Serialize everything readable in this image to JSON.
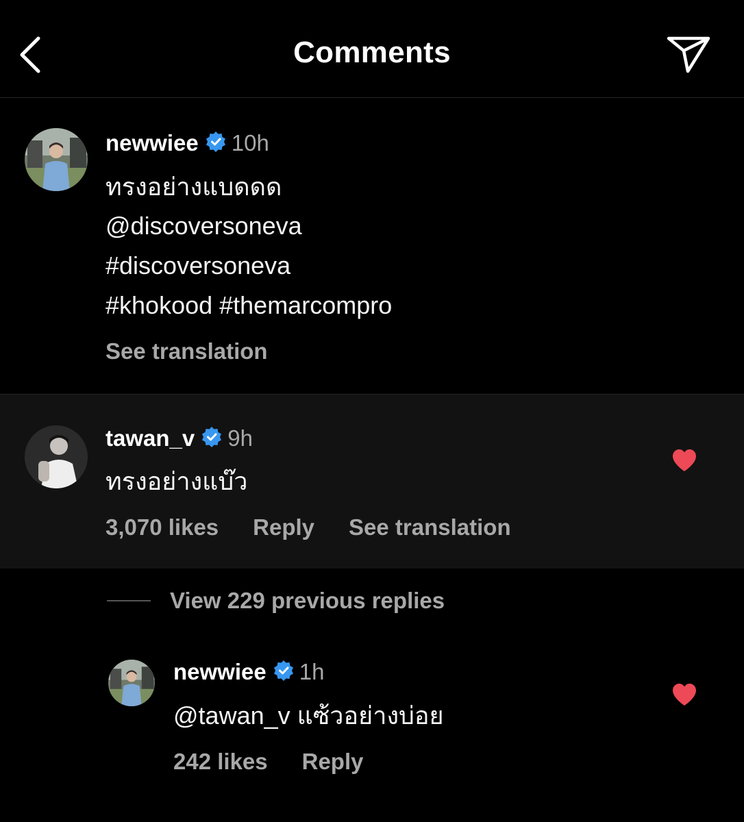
{
  "header": {
    "title": "Comments"
  },
  "caption": {
    "username": "newwiee",
    "time": "10h",
    "lines": [
      "ทรงอย่างแบดดด",
      "@discoversoneva",
      "#discoversoneva",
      "#khokood #themarcompro"
    ],
    "see_translation": "See translation"
  },
  "comment": {
    "username": "tawan_v",
    "time": "9h",
    "text": "ทรงอย่างแบ๊ว",
    "likes": "3,070 likes",
    "reply": "Reply",
    "see_translation": "See translation",
    "liked": true
  },
  "view_replies": "View 229 previous replies",
  "reply": {
    "username": "newwiee",
    "time": "1h",
    "mention": "@tawan_v",
    "text": "แซ้วอย่างบ่อย",
    "likes": "242 likes",
    "reply": "Reply",
    "liked": true
  },
  "colors": {
    "background": "#000000",
    "highlight_row": "#121212",
    "secondary_text": "#a8a8a8",
    "verified_badge": "#3897f0",
    "heart": "#ed4956"
  }
}
